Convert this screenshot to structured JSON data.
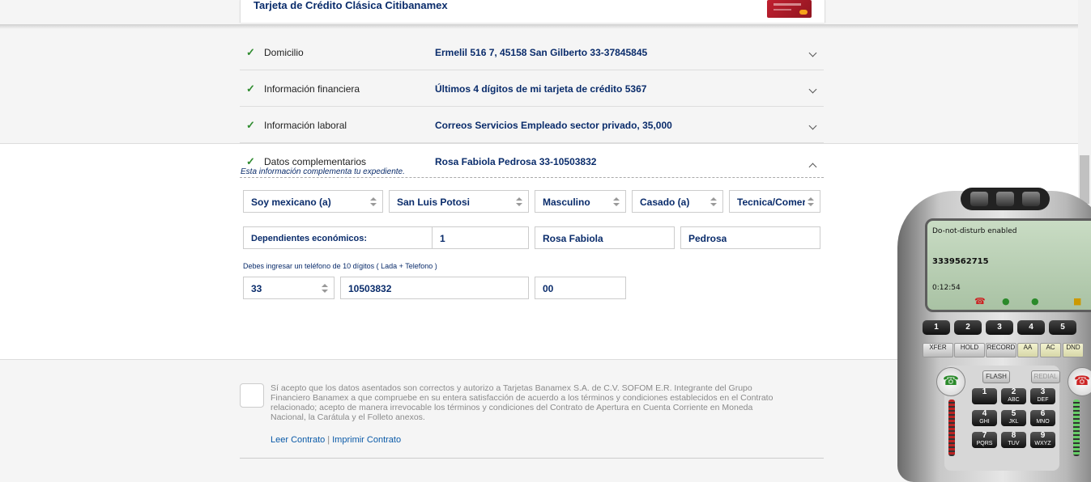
{
  "product": {
    "title": "Tarjeta de Crédito Clásica Citibanamex"
  },
  "summary_rows": [
    {
      "label": "Domicilio",
      "value": "Ermelil 516 7, 45158 San Gilberto 33-37845845"
    },
    {
      "label": "Información financiera",
      "value": "Últimos 4 dígitos de mi tarjeta de crédito 5367"
    },
    {
      "label": "Información laboral",
      "value": "Correos Servicios Empleado sector privado, 35,000"
    },
    {
      "label": "Datos complementarios",
      "value": "Rosa Fabiola Pedrosa 33-10503832"
    }
  ],
  "complementary": {
    "note": "Esta información complementa tu expediente.",
    "nationality": "Soy mexicano (a)",
    "state": "San Luis Potosi",
    "gender": "Masculino",
    "marital_status": "Casado (a)",
    "education": "Tecnica/Comercial",
    "dependents_label": "Dependientes económicos:",
    "dependents_value": "1",
    "ref_name": "Rosa Fabiola",
    "ref_last_name": "Pedrosa",
    "phone_hint": "Debes ingresar un teléfono de 10 dígitos ( Lada + Telefono )",
    "lada": "33",
    "phone": "10503832",
    "extension": "00"
  },
  "consent": {
    "text": "Sí acepto que los datos asentados son correctos y autorizo a Tarjetas Banamex S.A. de C.V. SOFOM E.R. Integrante del Grupo Financiero Banamex a que compruebe en su entera satisfacción de acuerdo a los términos y condiciones establecidos en el Contrato relacionado; acepto de manera irrevocable los términos y condiciones del Contrato de Apertura en Cuenta Corriente en Moneda Nacional, la Carátula y el Folleto anexos.",
    "link_read": "Leer Contrato",
    "separator": "|",
    "link_print": "Imprimir Contrato"
  },
  "softphone": {
    "status": "Do-not-disturb enabled",
    "number": "3339562715",
    "timer": "0:12:54",
    "line_keys": [
      "1",
      "2",
      "3",
      "4",
      "5"
    ],
    "function_keys": [
      "XFER",
      "HOLD",
      "RECORD",
      "AA",
      "AC",
      "DND"
    ],
    "flash": "FLASH",
    "redial": "REDIAL",
    "keys": [
      {
        "d": "1",
        "l": ""
      },
      {
        "d": "2",
        "l": "ABC"
      },
      {
        "d": "3",
        "l": "DEF"
      },
      {
        "d": "4",
        "l": "GHI"
      },
      {
        "d": "5",
        "l": "JKL"
      },
      {
        "d": "6",
        "l": "MNO"
      },
      {
        "d": "7",
        "l": "PQRS"
      },
      {
        "d": "8",
        "l": "TUV"
      },
      {
        "d": "9",
        "l": "WXYZ"
      }
    ]
  }
}
